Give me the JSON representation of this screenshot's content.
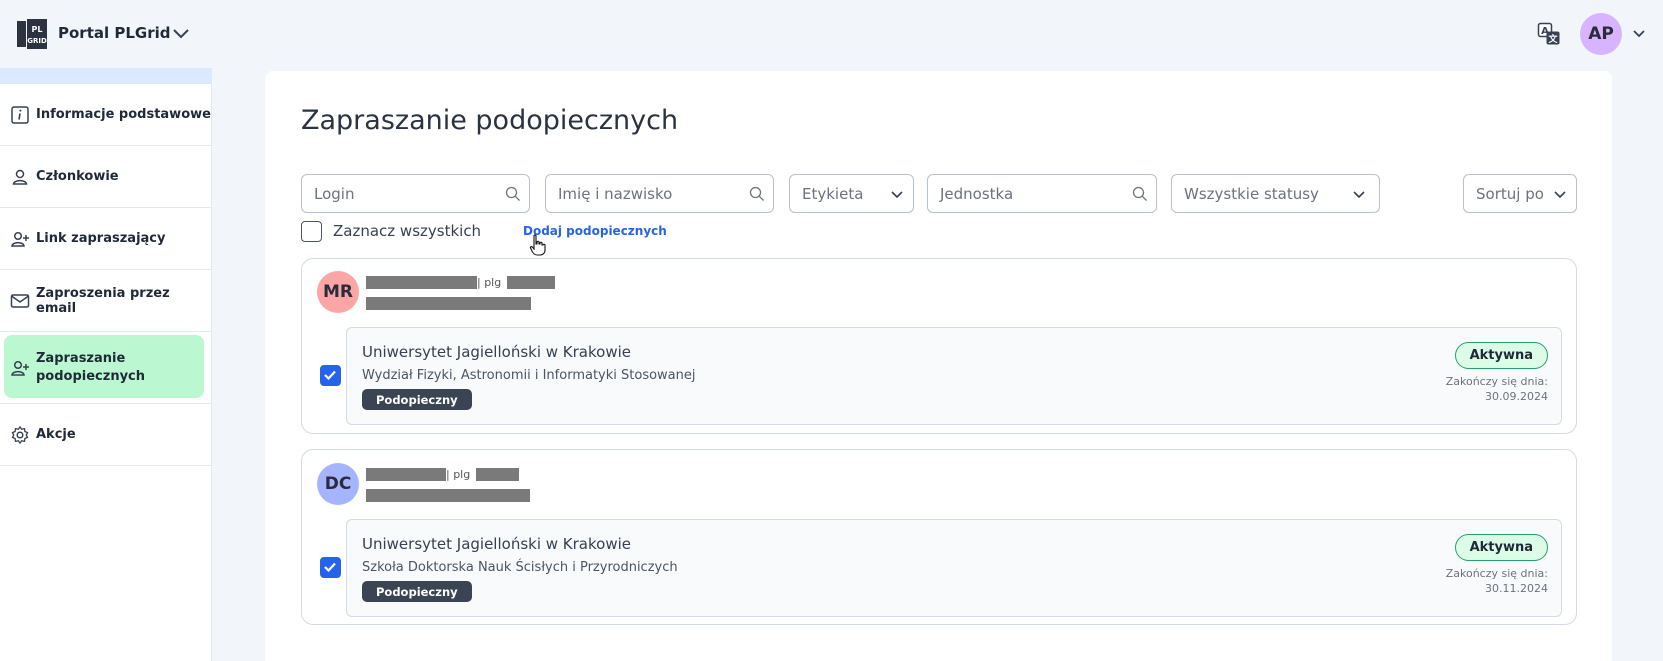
{
  "header": {
    "app_title": "Portal PLGrid",
    "user_initials": "AP"
  },
  "sidebar": {
    "items": [
      {
        "label": "Informacje podstawowe",
        "icon": "info-icon"
      },
      {
        "label": "Członkowie",
        "icon": "user-icon"
      },
      {
        "label": "Link zapraszający",
        "icon": "user-plus-icon"
      },
      {
        "label": "Zaproszenia przez email",
        "icon": "envelope-icon"
      },
      {
        "label": "Zapraszanie podopiecznych",
        "icon": "user-plus-icon",
        "active": true
      },
      {
        "label": "Akcje",
        "icon": "gear-icon"
      }
    ]
  },
  "main": {
    "title": "Zapraszanie podopiecznych",
    "filters": {
      "login_placeholder": "Login",
      "name_placeholder": "Imię i nazwisko",
      "label_select": "Etykieta",
      "unit_placeholder": "Jednostka",
      "status_select": "Wszystkie statusy",
      "sort_select": "Sortuj po"
    },
    "select_all_label": "Zaznacz wszystkich",
    "add_link": "Dodaj podopiecznych",
    "persons": [
      {
        "initials": "MR",
        "avatar_color": "#fca5a5",
        "login_prefix": "| plg",
        "affiliation": {
          "university": "Uniwersytet Jagielloński w Krakowie",
          "department": "Wydział Fizyki, Astronomii i Informatyki Stosowanej",
          "role": "Podopieczny",
          "status": "Aktywna",
          "ends_label": "Zakończy się dnia:",
          "ends_date": "30.09.2024",
          "checked": true
        }
      },
      {
        "initials": "DC",
        "avatar_color": "#a5b4fc",
        "login_prefix": "| plg",
        "affiliation": {
          "university": "Uniwersytet Jagielloński w Krakowie",
          "department": "Szkoła Doktorska Nauk Ścisłych i Przyrodniczych",
          "role": "Podopieczny",
          "status": "Aktywna",
          "ends_label": "Zakończy się dnia:",
          "ends_date": "30.11.2024",
          "checked": true
        }
      }
    ]
  },
  "colors": {
    "accent": "#2563eb",
    "active_nav": "#bbf7d0",
    "status_border": "#22a06b"
  }
}
